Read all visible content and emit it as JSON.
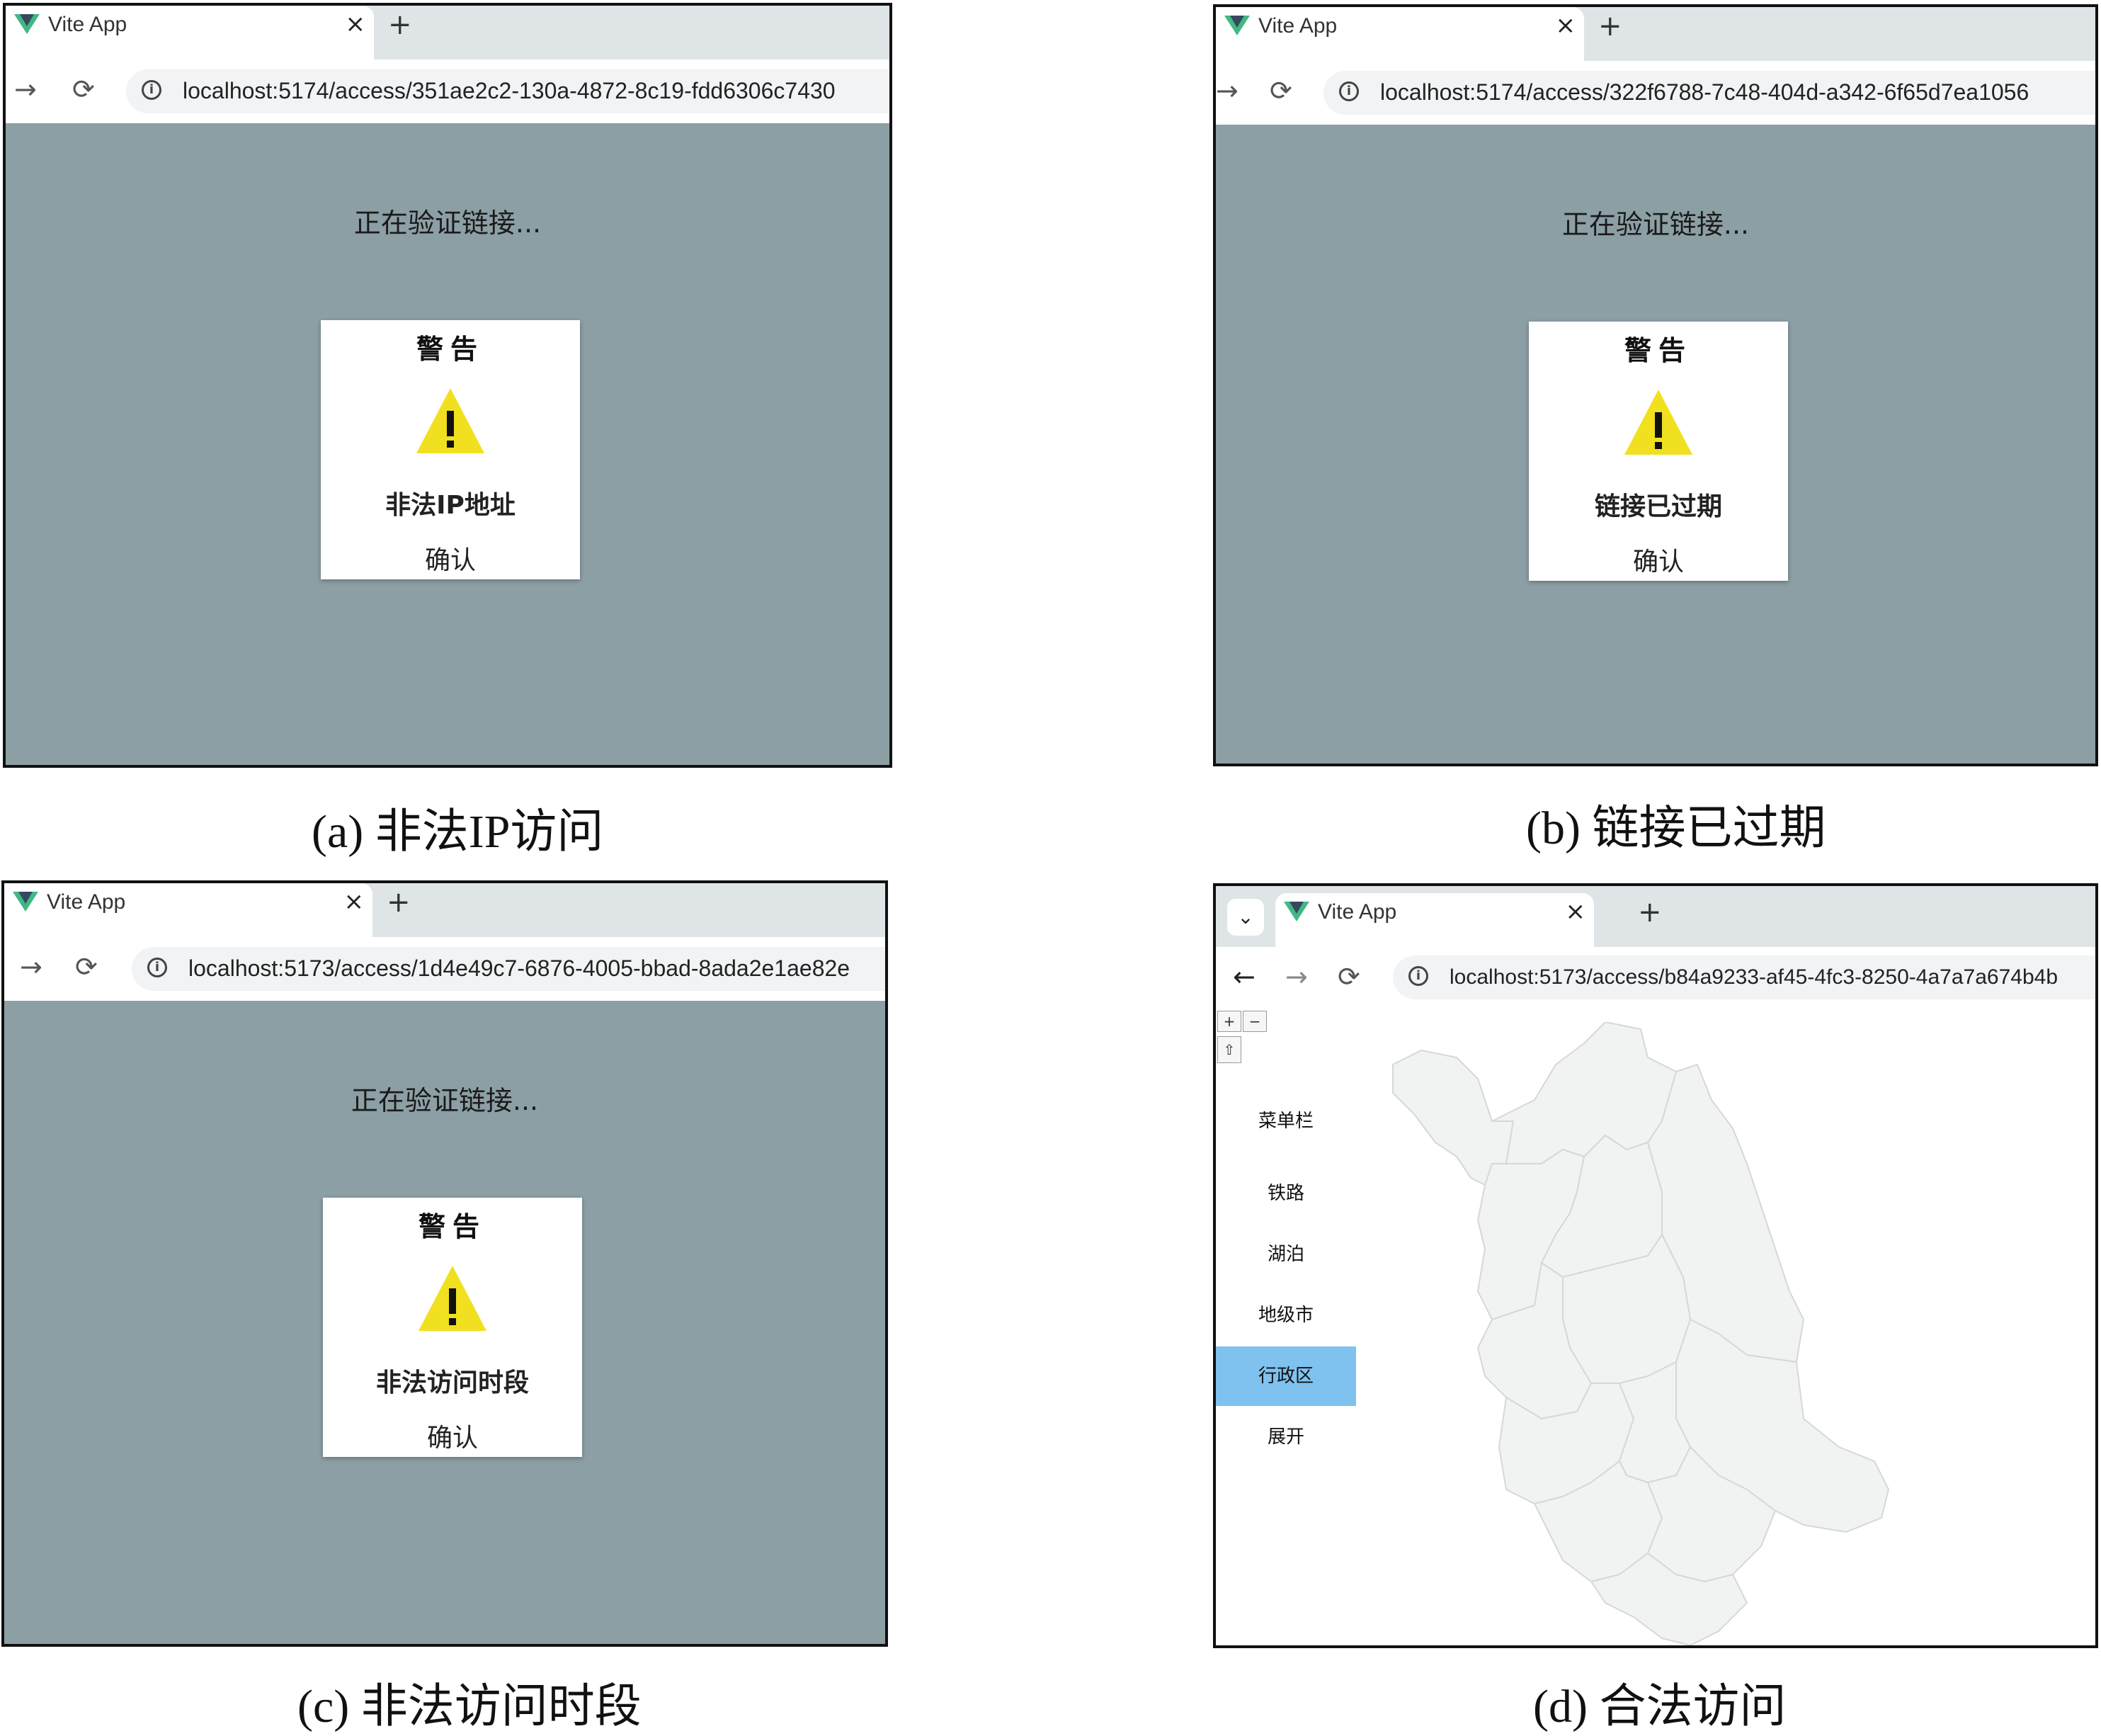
{
  "panels": {
    "a": {
      "tab_title": "Vite App",
      "tab_close": "×",
      "new_tab": "+",
      "nav_forward": "→",
      "nav_reload": "⟳",
      "info": "i",
      "url": "localhost:5174/access/351ae2c2-130a-4872-8c19-fdd6306c7430",
      "verify_text": "正在验证链接...",
      "dialog": {
        "title": "警告",
        "message": "非法IP地址",
        "confirm": "确认"
      },
      "caption": "(a) 非法IP访问"
    },
    "b": {
      "tab_title": "Vite App",
      "tab_close": "×",
      "new_tab": "+",
      "nav_forward": "→",
      "nav_reload": "⟳",
      "info": "i",
      "url": "localhost:5174/access/322f6788-7c48-404d-a342-6f65d7ea1056",
      "verify_text": "正在验证链接...",
      "dialog": {
        "title": "警告",
        "message": "链接已过期",
        "confirm": "确认"
      },
      "caption": "(b) 链接已过期"
    },
    "c": {
      "tab_title": "Vite App",
      "tab_close": "×",
      "new_tab": "+",
      "nav_forward": "→",
      "nav_reload": "⟳",
      "info": "i",
      "url": "localhost:5173/access/1d4e49c7-6876-4005-bbad-8ada2e1ae82e",
      "verify_text": "正在验证链接...",
      "dialog": {
        "title": "警告",
        "message": "非法访问时段",
        "confirm": "确认"
      },
      "caption": "(c) 非法访问时段"
    },
    "d": {
      "tab_dropdown": "⌄",
      "tab_title": "Vite App",
      "tab_close": "×",
      "new_tab": "+",
      "nav_back": "←",
      "nav_forward": "→",
      "nav_reload": "⟳",
      "info": "i",
      "url": "localhost:5173/access/b84a9233-af45-4fc3-8250-4a7a7a674b4b",
      "zoom_in": "+",
      "zoom_out": "−",
      "reset_north": "⇧",
      "menu": {
        "title": "菜单栏",
        "items": [
          "铁路",
          "湖泊",
          "地级市",
          "行政区",
          "展开"
        ],
        "active_index": 3
      },
      "caption": "(d) 合法访问"
    }
  },
  "colors": {
    "overlay_gray": "#8c9fa5",
    "warning_yellow": "#f0e020",
    "menu_active": "#7fc2ef",
    "map_fill": "#f1f2f2",
    "tab_strip": "#dfe5e6"
  },
  "icons": {
    "favicon": "vite-logo-icon",
    "warning": "warning-triangle-icon",
    "info": "info-icon"
  }
}
